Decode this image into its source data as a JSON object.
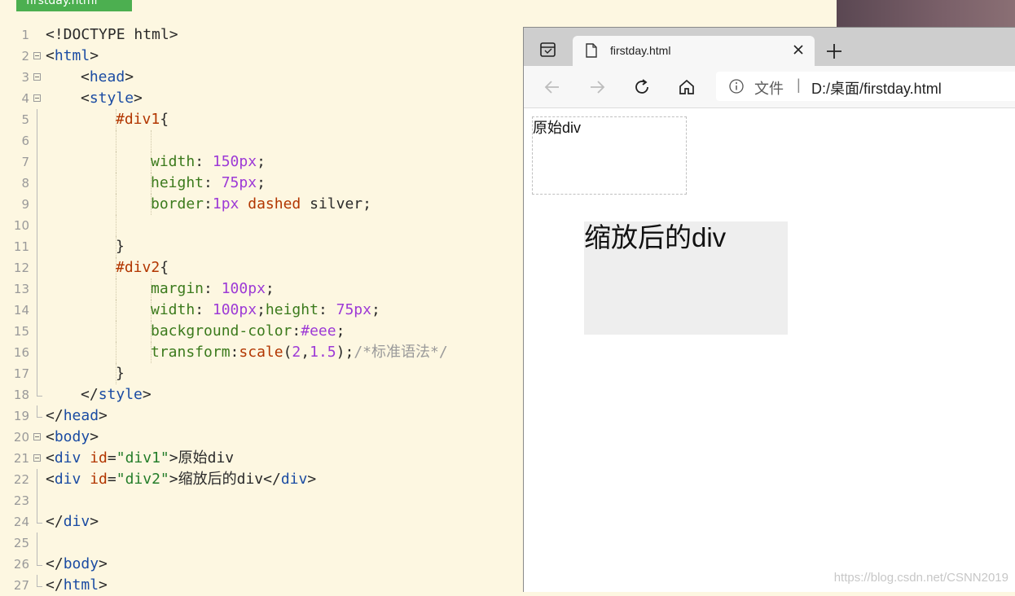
{
  "editor": {
    "file_tab": "firstday.html",
    "lines": [
      {
        "num": "1",
        "fold": "none",
        "indent": 0,
        "tokens": [
          {
            "c": "t-plain",
            "t": "<!DOCTYPE html>"
          }
        ]
      },
      {
        "num": "2",
        "fold": "open",
        "indent": 0,
        "tokens": [
          {
            "c": "t-br",
            "t": "<"
          },
          {
            "c": "t-tag",
            "t": "html"
          },
          {
            "c": "t-br",
            "t": ">"
          }
        ]
      },
      {
        "num": "3",
        "fold": "open",
        "indent": 1,
        "tokens": [
          {
            "c": "t-br",
            "t": "<"
          },
          {
            "c": "t-tag",
            "t": "head"
          },
          {
            "c": "t-br",
            "t": ">"
          }
        ]
      },
      {
        "num": "4",
        "fold": "open",
        "indent": 1,
        "tokens": [
          {
            "c": "t-br",
            "t": "<"
          },
          {
            "c": "t-tag",
            "t": "style"
          },
          {
            "c": "t-br",
            "t": ">"
          }
        ]
      },
      {
        "num": "5",
        "fold": "bar",
        "indent": 2,
        "tokens": [
          {
            "c": "t-sel",
            "t": "#div1"
          },
          {
            "c": "t-plain",
            "t": "{"
          }
        ]
      },
      {
        "num": "6",
        "fold": "bar",
        "indent": 3,
        "tokens": []
      },
      {
        "num": "7",
        "fold": "bar",
        "indent": 3,
        "tokens": [
          {
            "c": "t-prop",
            "t": "width"
          },
          {
            "c": "t-plain",
            "t": ": "
          },
          {
            "c": "t-num",
            "t": "150px"
          },
          {
            "c": "t-plain",
            "t": ";"
          }
        ]
      },
      {
        "num": "8",
        "fold": "bar",
        "indent": 3,
        "tokens": [
          {
            "c": "t-prop",
            "t": "height"
          },
          {
            "c": "t-plain",
            "t": ": "
          },
          {
            "c": "t-num",
            "t": "75px"
          },
          {
            "c": "t-plain",
            "t": ";"
          }
        ]
      },
      {
        "num": "9",
        "fold": "bar",
        "indent": 3,
        "tokens": [
          {
            "c": "t-prop",
            "t": "border"
          },
          {
            "c": "t-plain",
            "t": ":"
          },
          {
            "c": "t-num",
            "t": "1px"
          },
          {
            "c": "t-plain",
            "t": " "
          },
          {
            "c": "t-kw",
            "t": "dashed"
          },
          {
            "c": "t-plain",
            "t": " silver;"
          }
        ]
      },
      {
        "num": "10",
        "fold": "bar",
        "indent": 2,
        "tokens": []
      },
      {
        "num": "11",
        "fold": "bar",
        "indent": 2,
        "tokens": [
          {
            "c": "t-plain",
            "t": "}"
          }
        ]
      },
      {
        "num": "12",
        "fold": "bar",
        "indent": 2,
        "tokens": [
          {
            "c": "t-sel",
            "t": "#div2"
          },
          {
            "c": "t-plain",
            "t": "{"
          }
        ]
      },
      {
        "num": "13",
        "fold": "bar",
        "indent": 3,
        "tokens": [
          {
            "c": "t-prop",
            "t": "margin"
          },
          {
            "c": "t-plain",
            "t": ": "
          },
          {
            "c": "t-num",
            "t": "100px"
          },
          {
            "c": "t-plain",
            "t": ";"
          }
        ]
      },
      {
        "num": "14",
        "fold": "bar",
        "indent": 3,
        "tokens": [
          {
            "c": "t-prop",
            "t": "width"
          },
          {
            "c": "t-plain",
            "t": ": "
          },
          {
            "c": "t-num",
            "t": "100px"
          },
          {
            "c": "t-plain",
            "t": ";"
          },
          {
            "c": "t-prop",
            "t": "height"
          },
          {
            "c": "t-plain",
            "t": ": "
          },
          {
            "c": "t-num",
            "t": "75px"
          },
          {
            "c": "t-plain",
            "t": ";"
          }
        ]
      },
      {
        "num": "15",
        "fold": "bar",
        "indent": 3,
        "tokens": [
          {
            "c": "t-prop",
            "t": "background-color"
          },
          {
            "c": "t-plain",
            "t": ":"
          },
          {
            "c": "t-num",
            "t": "#eee"
          },
          {
            "c": "t-plain",
            "t": ";"
          }
        ]
      },
      {
        "num": "16",
        "fold": "bar",
        "indent": 3,
        "tokens": [
          {
            "c": "t-prop",
            "t": "transform"
          },
          {
            "c": "t-plain",
            "t": ":"
          },
          {
            "c": "t-fn",
            "t": "scale"
          },
          {
            "c": "t-plain",
            "t": "("
          },
          {
            "c": "t-num",
            "t": "2"
          },
          {
            "c": "t-plain",
            "t": ","
          },
          {
            "c": "t-num",
            "t": "1.5"
          },
          {
            "c": "t-plain",
            "t": ");"
          },
          {
            "c": "t-cm",
            "t": "/*标准语法*/"
          }
        ]
      },
      {
        "num": "17",
        "fold": "bar",
        "indent": 2,
        "tokens": [
          {
            "c": "t-plain",
            "t": "}"
          }
        ]
      },
      {
        "num": "18",
        "fold": "end",
        "indent": 1,
        "tokens": [
          {
            "c": "t-br",
            "t": "</"
          },
          {
            "c": "t-tag",
            "t": "style"
          },
          {
            "c": "t-br",
            "t": ">"
          }
        ]
      },
      {
        "num": "19",
        "fold": "end",
        "indent": 0,
        "tokens": [
          {
            "c": "t-br",
            "t": "</"
          },
          {
            "c": "t-tag",
            "t": "head"
          },
          {
            "c": "t-br",
            "t": ">"
          }
        ]
      },
      {
        "num": "20",
        "fold": "open",
        "indent": 0,
        "tokens": [
          {
            "c": "t-br",
            "t": "<"
          },
          {
            "c": "t-tag",
            "t": "body"
          },
          {
            "c": "t-br",
            "t": ">"
          }
        ]
      },
      {
        "num": "21",
        "fold": "open",
        "indent": 0,
        "tokens": [
          {
            "c": "t-br",
            "t": "<"
          },
          {
            "c": "t-tag",
            "t": "div"
          },
          {
            "c": "t-plain",
            "t": " "
          },
          {
            "c": "t-attr",
            "t": "id"
          },
          {
            "c": "t-plain",
            "t": "="
          },
          {
            "c": "t-str",
            "t": "\"div1\""
          },
          {
            "c": "t-br",
            "t": ">"
          },
          {
            "c": "t-plain",
            "t": "原始div"
          }
        ]
      },
      {
        "num": "22",
        "fold": "bar",
        "indent": 0,
        "tokens": [
          {
            "c": "t-br",
            "t": "<"
          },
          {
            "c": "t-tag",
            "t": "div"
          },
          {
            "c": "t-plain",
            "t": " "
          },
          {
            "c": "t-attr",
            "t": "id"
          },
          {
            "c": "t-plain",
            "t": "="
          },
          {
            "c": "t-str",
            "t": "\"div2\""
          },
          {
            "c": "t-br",
            "t": ">"
          },
          {
            "c": "t-plain",
            "t": "缩放后的div"
          },
          {
            "c": "t-br",
            "t": "</"
          },
          {
            "c": "t-tag",
            "t": "div"
          },
          {
            "c": "t-br",
            "t": ">"
          }
        ]
      },
      {
        "num": "23",
        "fold": "bar",
        "indent": 0,
        "tokens": []
      },
      {
        "num": "24",
        "fold": "end",
        "indent": 0,
        "tokens": [
          {
            "c": "t-br",
            "t": "</"
          },
          {
            "c": "t-tag",
            "t": "div"
          },
          {
            "c": "t-br",
            "t": ">"
          }
        ]
      },
      {
        "num": "25",
        "fold": "bar",
        "indent": 0,
        "tokens": []
      },
      {
        "num": "26",
        "fold": "end",
        "indent": 0,
        "tokens": [
          {
            "c": "t-br",
            "t": "</"
          },
          {
            "c": "t-tag",
            "t": "body"
          },
          {
            "c": "t-br",
            "t": ">"
          }
        ]
      },
      {
        "num": "27",
        "fold": "end",
        "indent": 0,
        "tokens": [
          {
            "c": "t-br",
            "t": "</"
          },
          {
            "c": "t-tag",
            "t": "html"
          },
          {
            "c": "t-br",
            "t": ">"
          }
        ]
      }
    ]
  },
  "browser": {
    "tab_title": "firstday.html",
    "address_scheme": "文件",
    "address_separator": "|",
    "address_url": "D:/桌面/firstday.html",
    "icons": {
      "tab_actions": "tab-actions-icon",
      "page": "page-icon",
      "close": "close-icon",
      "new_tab": "plus-icon",
      "back": "arrow-left-icon",
      "forward": "arrow-right-icon",
      "refresh": "refresh-icon",
      "home": "home-icon",
      "info": "info-icon"
    },
    "content": {
      "div1_text": "原始div",
      "div2_text": "缩放后的div",
      "div2_background": "#eeeeee"
    }
  },
  "watermark": "https://blog.csdn.net/CSNN2019"
}
